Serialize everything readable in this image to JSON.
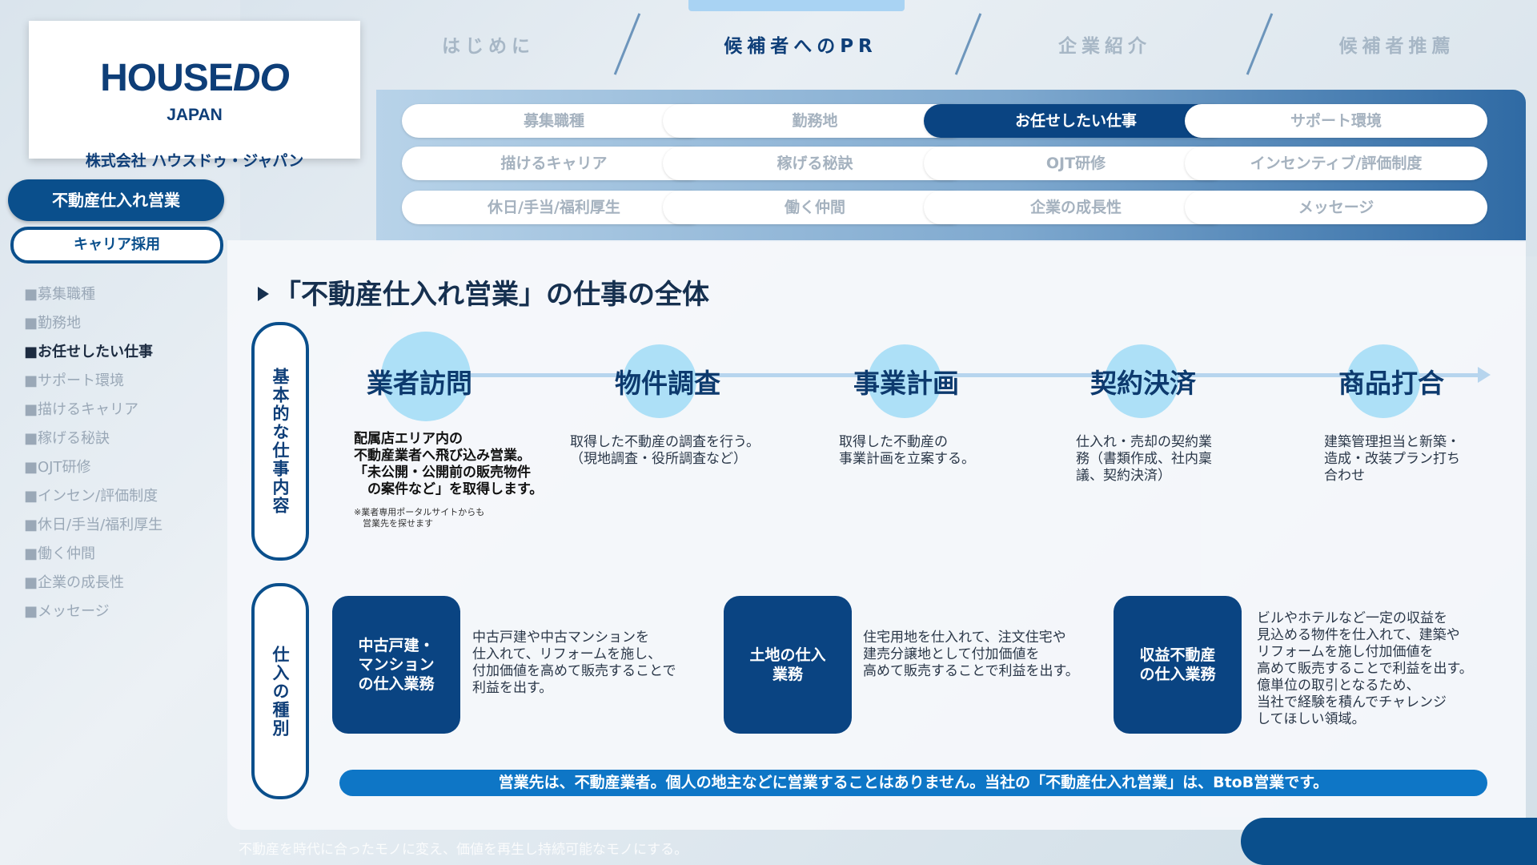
{
  "brand": {
    "logo_house": "HOUSE",
    "logo_do": "DO",
    "logo_sub": "JAPAN",
    "company": "株式会社 ハウスドゥ・ジャパン"
  },
  "sidebar": {
    "primary_button": "不動産仕入れ営業",
    "secondary_button": "キャリア採用",
    "items": [
      {
        "label": "■募集職種"
      },
      {
        "label": "■勤務地"
      },
      {
        "label": "■お任せしたい仕事"
      },
      {
        "label": "■サポート環境"
      },
      {
        "label": "■描けるキャリア"
      },
      {
        "label": "■稼げる秘訣"
      },
      {
        "label": "■OJT研修"
      },
      {
        "label": "■インセン/評価制度"
      },
      {
        "label": "■休日/手当/福利厚生"
      },
      {
        "label": "■働く仲間"
      },
      {
        "label": "■企業の成長性"
      },
      {
        "label": "■メッセージ"
      }
    ]
  },
  "top_nav": [
    {
      "label": "はじめに"
    },
    {
      "label": "候補者へのPR"
    },
    {
      "label": "企業紹介"
    },
    {
      "label": "候補者推薦"
    }
  ],
  "sub_tabs": [
    {
      "label": "募集職種"
    },
    {
      "label": "勤務地"
    },
    {
      "label": "お任せしたい仕事"
    },
    {
      "label": "サポート環境"
    },
    {
      "label": "描けるキャリア"
    },
    {
      "label": "稼げる秘訣"
    },
    {
      "label": "OJT研修"
    },
    {
      "label": "インセンティブ/評価制度"
    },
    {
      "label": "休日/手当/福利厚生"
    },
    {
      "label": "働く仲間"
    },
    {
      "label": "企業の成長性"
    },
    {
      "label": "メッセージ"
    }
  ],
  "main": {
    "title": "「不動産仕入れ営業」の仕事の全体",
    "label_flow": "基本的な仕事内容",
    "label_types": "仕入の種別",
    "flow": [
      {
        "title": "業者訪問",
        "desc": "配属店エリア内の\n不動産業者へ飛び込み営業。\n「未公開・公開前の販売物件\n　の案件など」を取得します。",
        "note": "※業者専用ポータルサイトからも\n　営業先を探せます"
      },
      {
        "title": "物件調査",
        "desc": "取得した不動産の調査を行う。\n（現地調査・役所調査など）"
      },
      {
        "title": "事業計画",
        "desc": "取得した不動産の\n事業計画を立案する。"
      },
      {
        "title": "契約決済",
        "desc": "仕入れ・売却の契約業\n務（書類作成、社内稟\n議、契約決済）"
      },
      {
        "title": "商品打合",
        "desc": "建築管理担当と新築・\n造成・改装プラン打ち\n合わせ"
      }
    ],
    "types": [
      {
        "name": "中古戸建・\nマンション\nの仕入業務",
        "desc": "中古戸建や中古マンションを\n仕入れて、リフォームを施し、\n付加価値を高めて販売することで\n利益を出す。"
      },
      {
        "name": "土地の仕入\n業務",
        "desc": "住宅用地を仕入れて、注文住宅や\n建売分譲地として付加価値を\n高めて販売することで利益を出す。"
      },
      {
        "name": "収益不動産\nの仕入業務",
        "desc": "ビルやホテルなど一定の収益を\n見込める物件を仕入れて、建築や\nリフォームを施し付加価値を\n高めて販売することで利益を出す。\n億単位の取引となるため、\n当社で経験を積んでチャレンジ\nしてほしい領域。"
      }
    ],
    "bottom_note": "営業先は、不動産業者。個人の地主などに営業することはありません。当社の「不動産仕入れ営業」は、BtoB営業です。"
  },
  "footer": {
    "tagline": "不動産を時代に合ったモノに変え、価値を再生し持続可能なモノにする。"
  },
  "colors": {
    "brand_navy": "#0a4482",
    "accent_blue": "#0e76c6",
    "circle_blue": "#ade0f7"
  }
}
